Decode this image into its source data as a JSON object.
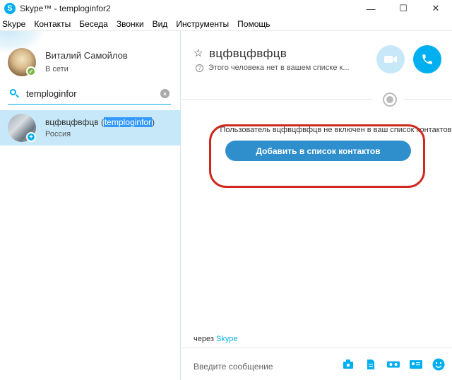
{
  "window": {
    "title": "Skype™ - temploginfor2",
    "app_icon_letter": "S",
    "minimize": "—",
    "maximize": "☐",
    "close": "✕"
  },
  "menu": [
    "Skype",
    "Контакты",
    "Беседа",
    "Звонки",
    "Вид",
    "Инструменты",
    "Помощь"
  ],
  "profile": {
    "name": "Виталий Самойлов",
    "status": "В сети"
  },
  "search": {
    "value": "temploginfor",
    "clear": "×"
  },
  "contact": {
    "name_prefix": "вцфвцфвфцв (",
    "name_highlight": "temploginfor",
    "name_suffix": ")",
    "location": "Россия",
    "badge": "+"
  },
  "conversation": {
    "star": "☆",
    "title": "вцфвцфвфцв",
    "info": "?",
    "subtitle": "Этого человека нет в вашем списке к...",
    "notice": "Пользователь вцфвцфвфцв не включен в ваш список контактов",
    "add_button": "Добавить в список контактов",
    "via_prefix": "через",
    "via_link": "Skype",
    "compose_placeholder": "Введите сообщение"
  },
  "colors": {
    "accent": "#00aff0",
    "selected_row": "#c6e8f8",
    "add_button": "#2f8fcc",
    "annotation_oval": "#d0281c",
    "online": "#7cb342"
  }
}
